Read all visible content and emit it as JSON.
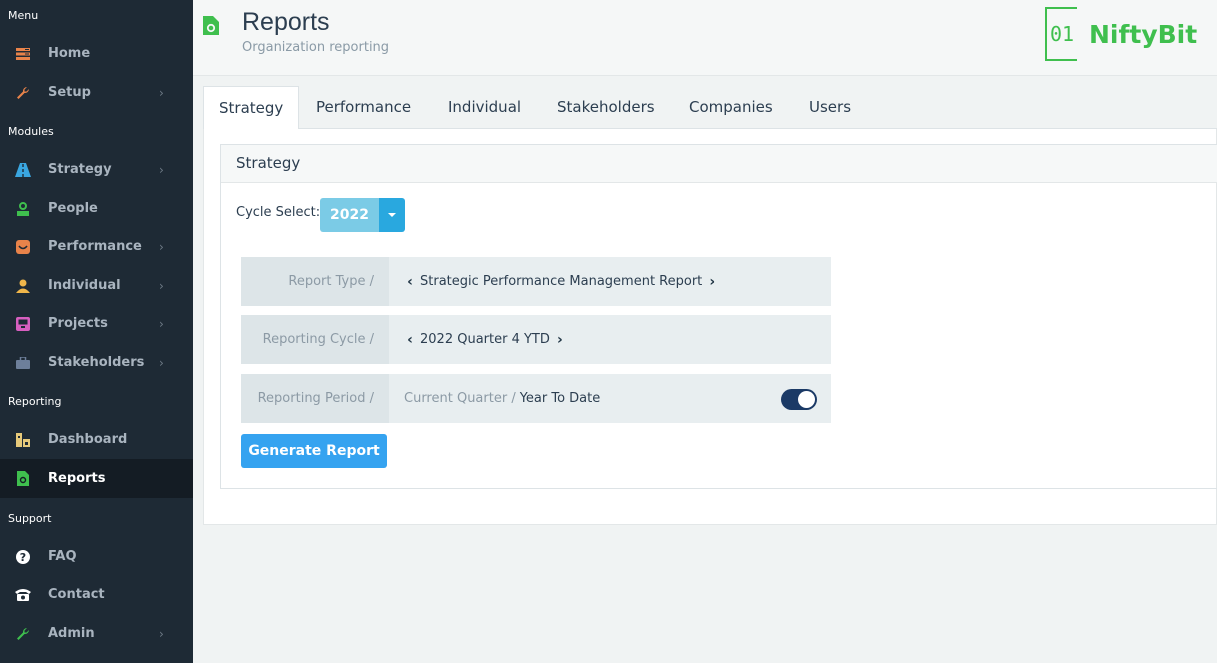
{
  "sidebar": {
    "sections": [
      "Menu",
      "Modules",
      "Reporting",
      "Support"
    ],
    "items": [
      {
        "label": "Home",
        "icon": "home-icon",
        "chevron": false
      },
      {
        "label": "Setup",
        "icon": "wrench-icon",
        "chevron": true
      },
      {
        "label": "Strategy",
        "icon": "road-icon",
        "chevron": true
      },
      {
        "label": "People",
        "icon": "people-icon",
        "chevron": false
      },
      {
        "label": "Performance",
        "icon": "performance-icon",
        "chevron": true
      },
      {
        "label": "Individual",
        "icon": "user-icon",
        "chevron": true
      },
      {
        "label": "Projects",
        "icon": "inbox-icon",
        "chevron": true
      },
      {
        "label": "Stakeholders",
        "icon": "briefcase-icon",
        "chevron": true
      },
      {
        "label": "Dashboard",
        "icon": "dashboard-icon",
        "chevron": false
      },
      {
        "label": "Reports",
        "icon": "report-icon",
        "chevron": false,
        "active": true
      },
      {
        "label": "FAQ",
        "icon": "question-icon",
        "chevron": false
      },
      {
        "label": "Contact",
        "icon": "phone-icon",
        "chevron": false
      },
      {
        "label": "Admin",
        "icon": "wrench-icon",
        "chevron": true
      }
    ]
  },
  "header": {
    "title": "Reports",
    "subtitle": "Organization reporting",
    "logo_mark": "01",
    "logo_text": "NiftyBit"
  },
  "tabs": [
    "Strategy",
    "Performance",
    "Individual",
    "Stakeholders",
    "Companies",
    "Users"
  ],
  "panel": {
    "title": "Strategy",
    "cycle_label": "Cycle Select:",
    "cycle_value": "2022",
    "rows": {
      "report_type": {
        "label": "Report Type /",
        "value": "Strategic Performance Management Report"
      },
      "reporting_cycle": {
        "label": "Reporting Cycle /",
        "value": "2022 Quarter 4 YTD"
      },
      "reporting_period": {
        "label": "Reporting Period /",
        "option_a": "Current Quarter /",
        "option_b": "Year To Date",
        "toggle_on": true
      }
    },
    "generate_label": "Generate Report"
  },
  "colors": {
    "sidebar_bg": "#1e2a35",
    "accent_blue": "#35a3f0",
    "brand_green": "#3fbf4e",
    "toggle_navy": "#1b3a66"
  }
}
